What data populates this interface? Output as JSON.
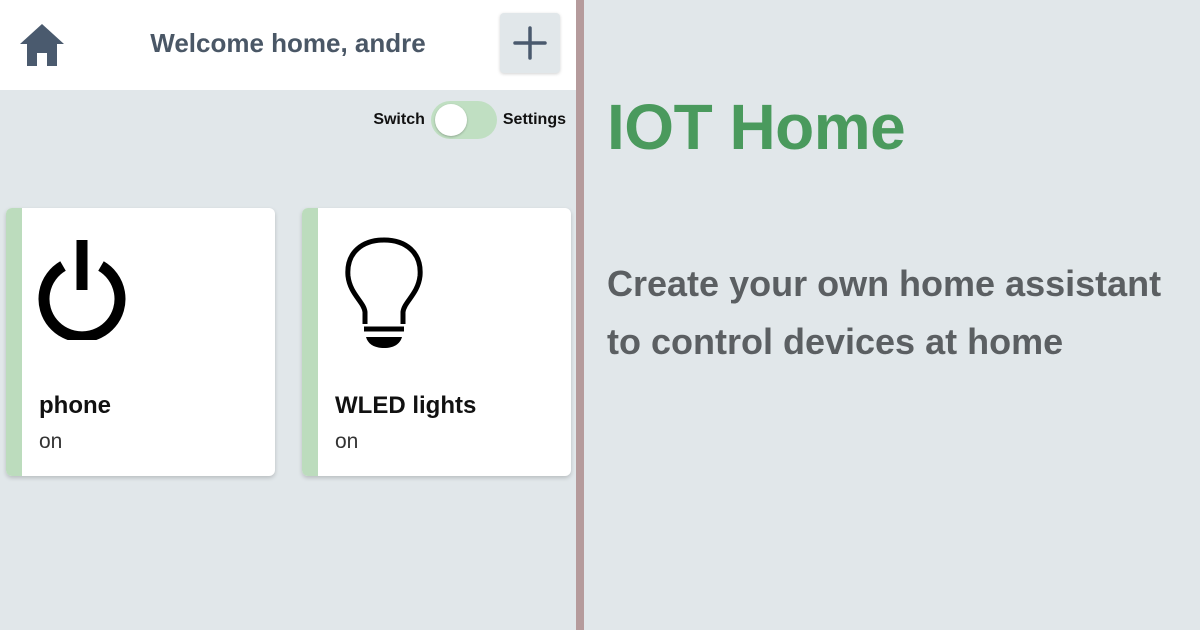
{
  "header": {
    "title": "Welcome home, andre",
    "home_icon": "home-icon",
    "add_icon": "plus-icon"
  },
  "view_toggle": {
    "left_label": "Switch",
    "right_label": "Settings",
    "state": "switch"
  },
  "devices": [
    {
      "name": "phone",
      "status": "on",
      "icon": "power-icon"
    },
    {
      "name": "WLED lights",
      "status": "on",
      "icon": "lightbulb-icon"
    }
  ],
  "promo": {
    "title": "IOT Home",
    "tagline_line1": "Create your own home assistant",
    "tagline_line2": "to control devices at home"
  },
  "colors": {
    "accent_green": "#4a9a5d",
    "card_accent": "#bcdcbd",
    "background": "#e1e7ea",
    "divider": "#b59b9c",
    "header_text": "#4a5766"
  }
}
